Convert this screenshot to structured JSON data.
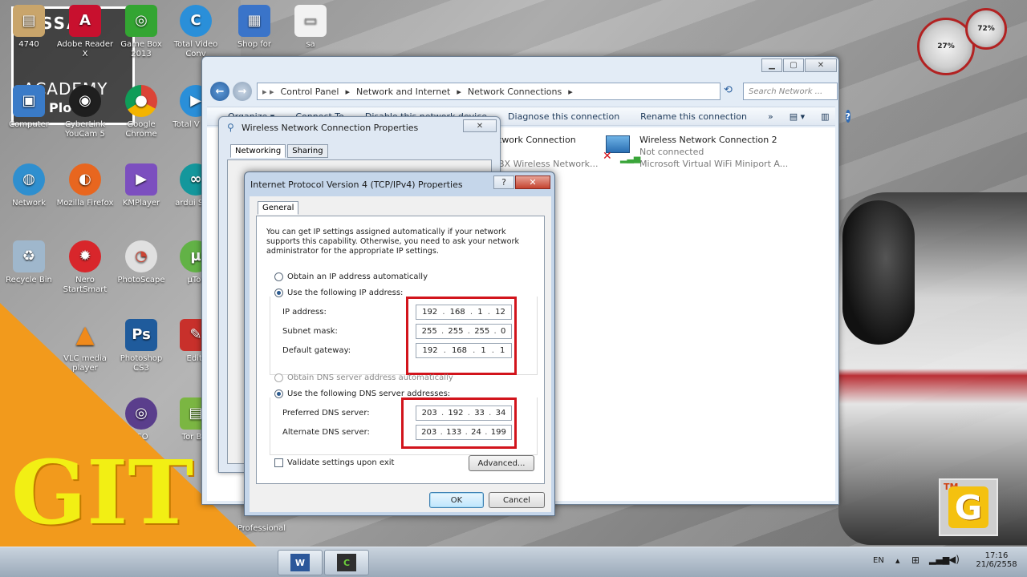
{
  "desktop": {
    "icons": [
      {
        "id": "4740",
        "label": "4740",
        "color": "#c9a56b"
      },
      {
        "id": "adobe",
        "label": "Adobe Reader X",
        "color": "#c8102e"
      },
      {
        "id": "gamebox",
        "label": "Game Box 2013",
        "color": "#33a532"
      },
      {
        "id": "totalvideo",
        "label": "Total Video Conv",
        "color": "#2a8fd9"
      },
      {
        "id": "shopfor",
        "label": "Shop for",
        "color": "#3a74c9"
      },
      {
        "id": "sa",
        "label": "sa",
        "color": "#f2f2f2"
      },
      {
        "id": "computer",
        "label": "Computer",
        "color": "#3a7bc8"
      },
      {
        "id": "youcam",
        "label": "CyberLink YouCam 5",
        "color": "#1f1f1f"
      },
      {
        "id": "chrome",
        "label": "Google Chrome",
        "color": "#e3a513"
      },
      {
        "id": "totalplay",
        "label": "Total V Play",
        "color": "#2a8fd9"
      },
      {
        "id": "network",
        "label": "Network",
        "color": "#2f8fcf"
      },
      {
        "id": "firefox",
        "label": "Mozilla Firefox",
        "color": "#e8661f"
      },
      {
        "id": "kmplayer",
        "label": "KMPlayer",
        "color": "#7c4fbf"
      },
      {
        "id": "arduino",
        "label": "ardui Shor",
        "color": "#14979c"
      },
      {
        "id": "recycle",
        "label": "Recycle Bin",
        "color": "#9fb7cc"
      },
      {
        "id": "nero",
        "label": "Nero StartSmart",
        "color": "#d8262b"
      },
      {
        "id": "photoscape",
        "label": "PhotoScape",
        "color": "#e0e0e0"
      },
      {
        "id": "utorrent",
        "label": "µTor",
        "color": "#62b246"
      },
      {
        "id": "vlc",
        "label": "VLC media player",
        "color": "#f08a1c"
      },
      {
        "id": "photoshop",
        "label": "Photoshop CS3",
        "color": "#1f5b9c"
      },
      {
        "id": "editplus",
        "label": "Edit-",
        "color": "#c8302b"
      },
      {
        "id": "vso",
        "label": "ISO",
        "color": "#5a3e8c"
      },
      {
        "id": "torbrowser",
        "label": "Tor Bro",
        "color": "#7bb642"
      },
      {
        "id": "professional",
        "label": "Professional",
        "color": "#f2f2f2"
      }
    ],
    "academy": {
      "line1": "NISSAN",
      "line2": "ACADEMY",
      "line3": "Plo on"
    },
    "gauges": {
      "gauge1": "27%",
      "gauge2": "72%"
    },
    "git_text": "GIT",
    "tmg": {
      "tm": "TM",
      "letter": "G"
    }
  },
  "explorer": {
    "breadcrumb": [
      "Control Panel",
      "Network and Internet",
      "Network Connections"
    ],
    "search_placeholder": "Search Network ...",
    "commands": [
      "Organize ▾",
      "Connect To",
      "Disable this network device",
      "Diagnose this connection",
      "Rename this connection",
      "»"
    ],
    "connections": [
      {
        "name": "twork Connection",
        "sub": "",
        "detail": "BX Wireless Network..."
      },
      {
        "name": "Wireless Network Connection 2",
        "sub": "Not connected",
        "detail": "Microsoft Virtual WiFi Miniport A..."
      }
    ]
  },
  "wireless_props": {
    "title": "Wireless Network Connection Properties",
    "tabs": [
      "Networking",
      "Sharing"
    ]
  },
  "ipv4": {
    "title": "Internet Protocol Version 4 (TCP/IPv4) Properties",
    "help": "?",
    "close": "✕",
    "tab": "General",
    "description": "You can get IP settings assigned automatically if your network supports this capability. Otherwise, you need to ask your network administrator for the appropriate IP settings.",
    "radio_auto_ip": "Obtain an IP address automatically",
    "radio_manual_ip": "Use the following IP address:",
    "ip_label": "IP address:",
    "subnet_label": "Subnet mask:",
    "gateway_label": "Default gateway:",
    "ip": [
      "192",
      "168",
      "1",
      "12"
    ],
    "subnet": [
      "255",
      "255",
      "255",
      "0"
    ],
    "gateway": [
      "192",
      "168",
      "1",
      "1"
    ],
    "radio_auto_dns": "Obtain DNS server address automatically",
    "radio_manual_dns": "Use the following DNS server addresses:",
    "preferred_label": "Preferred DNS server:",
    "alternate_label": "Alternate DNS server:",
    "preferred": [
      "203",
      "192",
      "33",
      "34"
    ],
    "alternate": [
      "203",
      "133",
      "24",
      "199"
    ],
    "validate_label": "Validate settings upon exit",
    "advanced": "Advanced...",
    "ok": "OK",
    "cancel": "Cancel"
  },
  "taskbar": {
    "lang": "EN",
    "time": "17:16",
    "date": "21/6/2558"
  }
}
